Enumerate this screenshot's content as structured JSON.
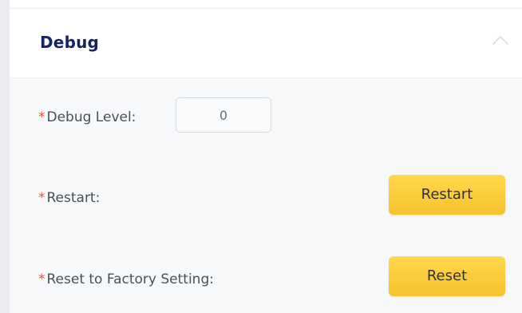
{
  "section": {
    "title": "Debug",
    "collapse_icon": "chevron-up-icon"
  },
  "fields": {
    "required_mark": "*",
    "debug_level": {
      "label": "Debug Level:",
      "value": "0"
    },
    "restart": {
      "label": "Restart:",
      "button_label": "Restart"
    },
    "reset": {
      "label": "Reset to Factory Setting:",
      "button_label": "Reset"
    }
  },
  "colors": {
    "title": "#152362",
    "required": "#e2553d",
    "button": "#ffd84b",
    "panel_background": "#f7f8fa"
  }
}
